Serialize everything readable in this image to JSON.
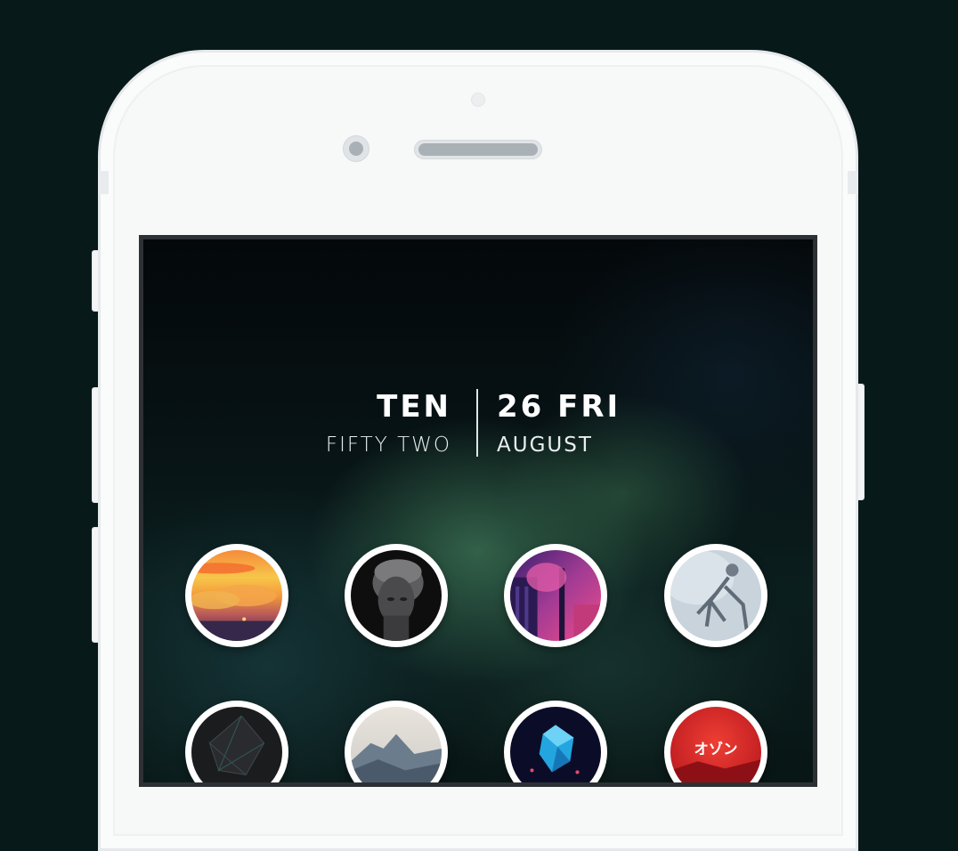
{
  "lockscreen": {
    "clock": {
      "hour": "TEN",
      "minute": "FIFTY TWO",
      "day_date": "26 FRI",
      "month": "AUGUST"
    }
  },
  "apps": [
    {
      "icon": "sunset-clouds-icon"
    },
    {
      "icon": "statue-head-icon"
    },
    {
      "icon": "neon-street-icon"
    },
    {
      "icon": "skeleton-figure-icon"
    },
    {
      "icon": "dark-polygon-icon"
    },
    {
      "icon": "mountain-peak-icon"
    },
    {
      "icon": "blue-crystal-icon"
    },
    {
      "icon": "red-sun-icon",
      "label": "オゾン"
    }
  ]
}
